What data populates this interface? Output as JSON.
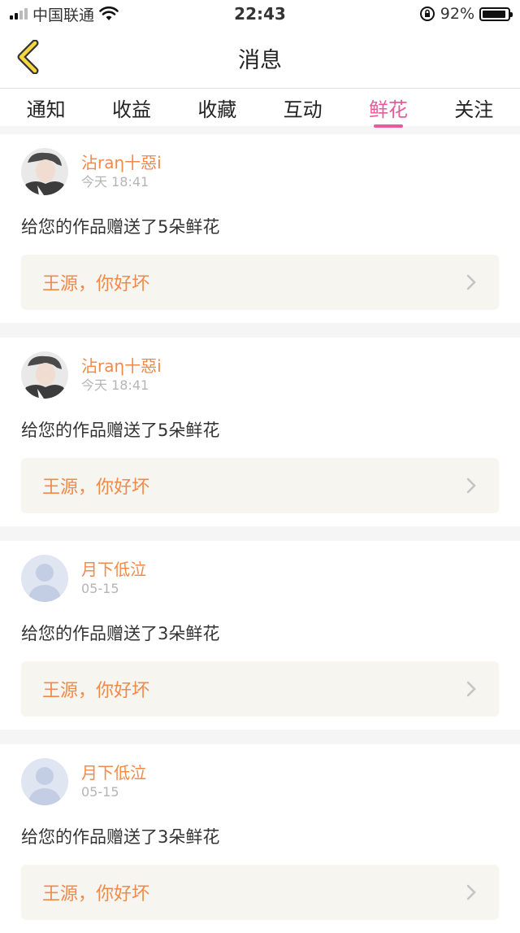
{
  "status": {
    "carrier": "中国联通",
    "time": "22:43",
    "battery": "92%",
    "battery_level": 0.92
  },
  "nav": {
    "title": "消息"
  },
  "tabs": [
    {
      "label": "通知",
      "active": false
    },
    {
      "label": "收益",
      "active": false
    },
    {
      "label": "收藏",
      "active": false
    },
    {
      "label": "互动",
      "active": false
    },
    {
      "label": "鲜花",
      "active": true
    },
    {
      "label": "关注",
      "active": false
    }
  ],
  "notifications": [
    {
      "username": "沾rаη十惡i",
      "time": "今天 18:41",
      "message": "给您的作品赠送了5朵鲜花",
      "work_title": "王源，你好坏",
      "avatar": "photo-avatar"
    },
    {
      "username": "沾rаη十惡i",
      "time": "今天 18:41",
      "message": "给您的作品赠送了5朵鲜花",
      "work_title": "王源，你好坏",
      "avatar": "photo-avatar"
    },
    {
      "username": "月下低泣",
      "time": "05-15",
      "message": "给您的作品赠送了3朵鲜花",
      "work_title": "王源，你好坏",
      "avatar": "default-avatar"
    },
    {
      "username": "月下低泣",
      "time": "05-15",
      "message": "给您的作品赠送了3朵鲜花",
      "work_title": "王源，你好坏",
      "avatar": "default-avatar"
    }
  ],
  "colors": {
    "accent": "#e85a9d",
    "username": "#f08a4b",
    "work_bg": "#f6f5ef"
  }
}
